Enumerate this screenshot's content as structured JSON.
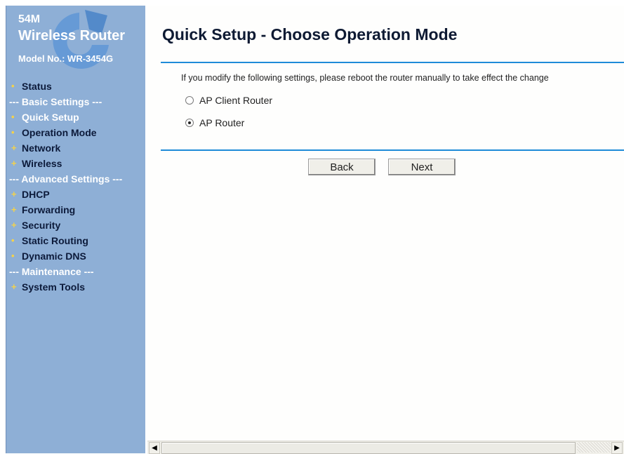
{
  "sidebar": {
    "brand": {
      "line1": "54M",
      "line2": "Wireless Router",
      "model": "Model No.: WR-3454G"
    },
    "menu": [
      {
        "label": "Status",
        "bullet": "•"
      },
      {
        "label": "--- Basic Settings ---"
      },
      {
        "label": "Quick Setup",
        "bullet": "•"
      },
      {
        "label": "Operation Mode",
        "bullet": "•"
      },
      {
        "label": "Network",
        "bullet": "+"
      },
      {
        "label": "Wireless",
        "bullet": "+"
      },
      {
        "label": "--- Advanced Settings ---"
      },
      {
        "label": "DHCP",
        "bullet": "+"
      },
      {
        "label": "Forwarding",
        "bullet": "+"
      },
      {
        "label": "Security",
        "bullet": "+"
      },
      {
        "label": "Static Routing",
        "bullet": "•"
      },
      {
        "label": "Dynamic DNS",
        "bullet": "•"
      },
      {
        "label": "--- Maintenance ---"
      },
      {
        "label": "System Tools",
        "bullet": "+"
      }
    ]
  },
  "main": {
    "title": "Quick Setup - Choose Operation Mode",
    "notice": "If you modify the following settings, please reboot the router manually to take effect the change",
    "options": [
      {
        "label": "AP Client Router",
        "checked": false
      },
      {
        "label": "AP Router",
        "checked": true
      }
    ],
    "back_label": "Back",
    "next_label": "Next"
  },
  "scrollbar": {
    "left_arrow": "◀",
    "right_arrow": "▶"
  },
  "colors": {
    "sidebar_bg": "#8eafd6",
    "rule": "#1f8bd8",
    "bullet": "#f4d24a"
  }
}
